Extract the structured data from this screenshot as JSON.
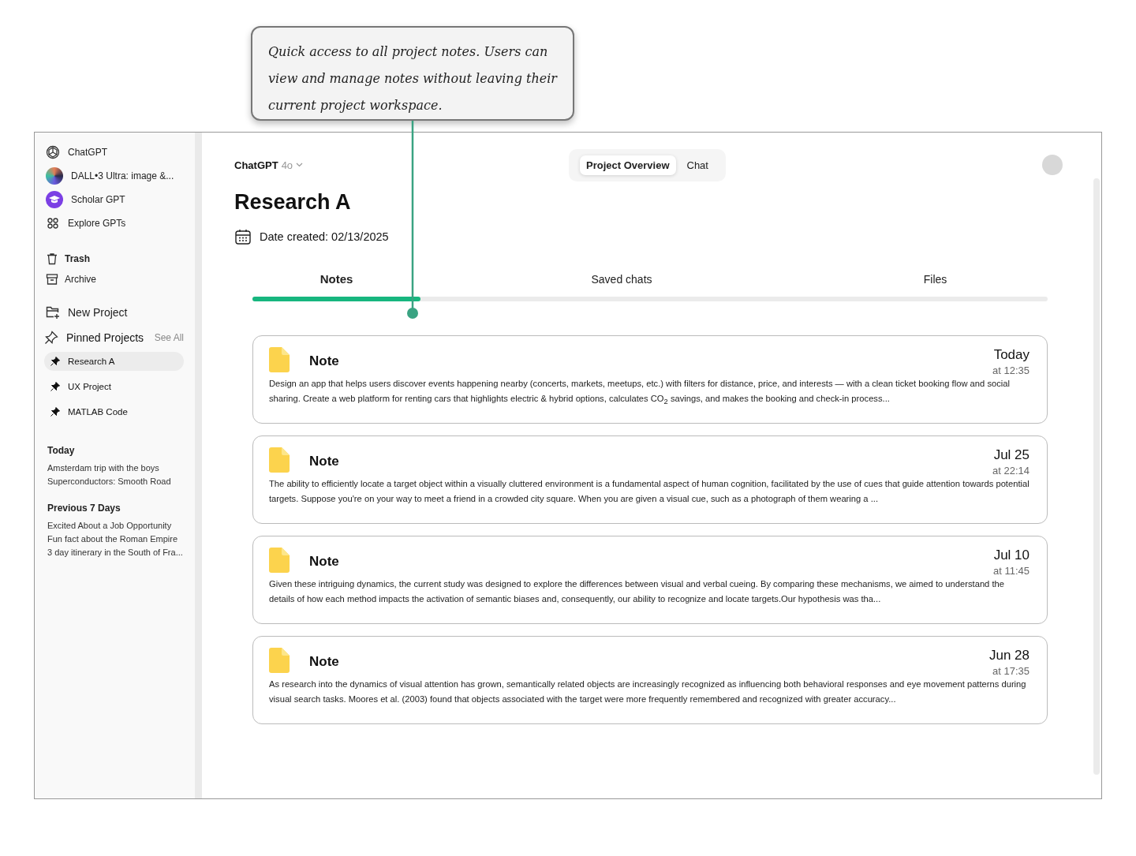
{
  "annotation": {
    "text": "Quick access to all project notes. Users can view and manage notes without leaving their current project workspace."
  },
  "sidebar": {
    "gpts": [
      {
        "label": "ChatGPT"
      },
      {
        "label": "DALL•3 Ultra: image &..."
      },
      {
        "label": "Scholar GPT"
      },
      {
        "label": "Explore GPTs"
      }
    ],
    "utility": [
      {
        "label": "Trash"
      },
      {
        "label": "Archive"
      }
    ],
    "new_project": "New Project",
    "pinned": {
      "title": "Pinned Projects",
      "see_all": "See All",
      "items": [
        {
          "label": "Research A",
          "selected": true
        },
        {
          "label": "UX Project",
          "selected": false
        },
        {
          "label": "MATLAB Code",
          "selected": false
        }
      ]
    },
    "history": [
      {
        "heading": "Today",
        "items": [
          "Amsterdam trip with the boys",
          "Superconductors: Smooth Road"
        ]
      },
      {
        "heading": "Previous 7 Days",
        "items": [
          "Excited About a Job Opportunity",
          "Fun fact about the Roman Empire",
          "3 day itinerary in the South of Fra..."
        ]
      }
    ]
  },
  "header": {
    "model": "ChatGPT",
    "version": "4o",
    "toggle": [
      {
        "label": "Project Overview",
        "selected": true
      },
      {
        "label": "Chat",
        "selected": false
      }
    ]
  },
  "project": {
    "title": "Research A",
    "date_created": "Date created: 02/13/2025"
  },
  "tabs": [
    {
      "label": "Notes",
      "selected": true
    },
    {
      "label": "Saved chats",
      "selected": false
    },
    {
      "label": "Files",
      "selected": false
    }
  ],
  "notes": [
    {
      "title": "Note",
      "date": "Today",
      "time": "at 12:35",
      "text": "Design an app that helps users discover events happening nearby (concerts, markets, meetups, etc.) with filters for distance, price, and interests — with a clean ticket booking flow and social sharing. Create a web platform for renting cars that highlights electric & hybrid options, calculates CO$_{2}$ savings, and makes the booking and check-in process..."
    },
    {
      "title": "Note",
      "date": "Jul 25",
      "time": "at 22:14",
      "text": "The ability to efficiently locate a target object within a visually cluttered environment is a fundamental aspect of human cognition, facilitated by the use of cues that guide attention towards potential targets. Suppose you're on your way to meet a friend in a crowded city square. When you are given a visual cue, such as a photograph of them wearing a ..."
    },
    {
      "title": "Note",
      "date": "Jul 10",
      "time": "at 11:45",
      "text": "Given these intriguing dynamics, the current study was designed to explore the differences between visual and verbal cueing. By comparing these mechanisms, we aimed to understand the details of how each method impacts the activation of semantic biases and, consequently, our ability to recognize and locate targets.Our hypothesis was tha..."
    },
    {
      "title": "Note",
      "date": "Jun 28",
      "time": "at 17:35",
      "text": "As research into the dynamics of visual attention has grown, semantically related objects are increasingly recognized as influencing both behavioral responses and eye movement patterns during visual search tasks. Moores et al. (2003) found that objects associated with the target were more frequently remembered and recognized with greater accuracy..."
    }
  ]
}
